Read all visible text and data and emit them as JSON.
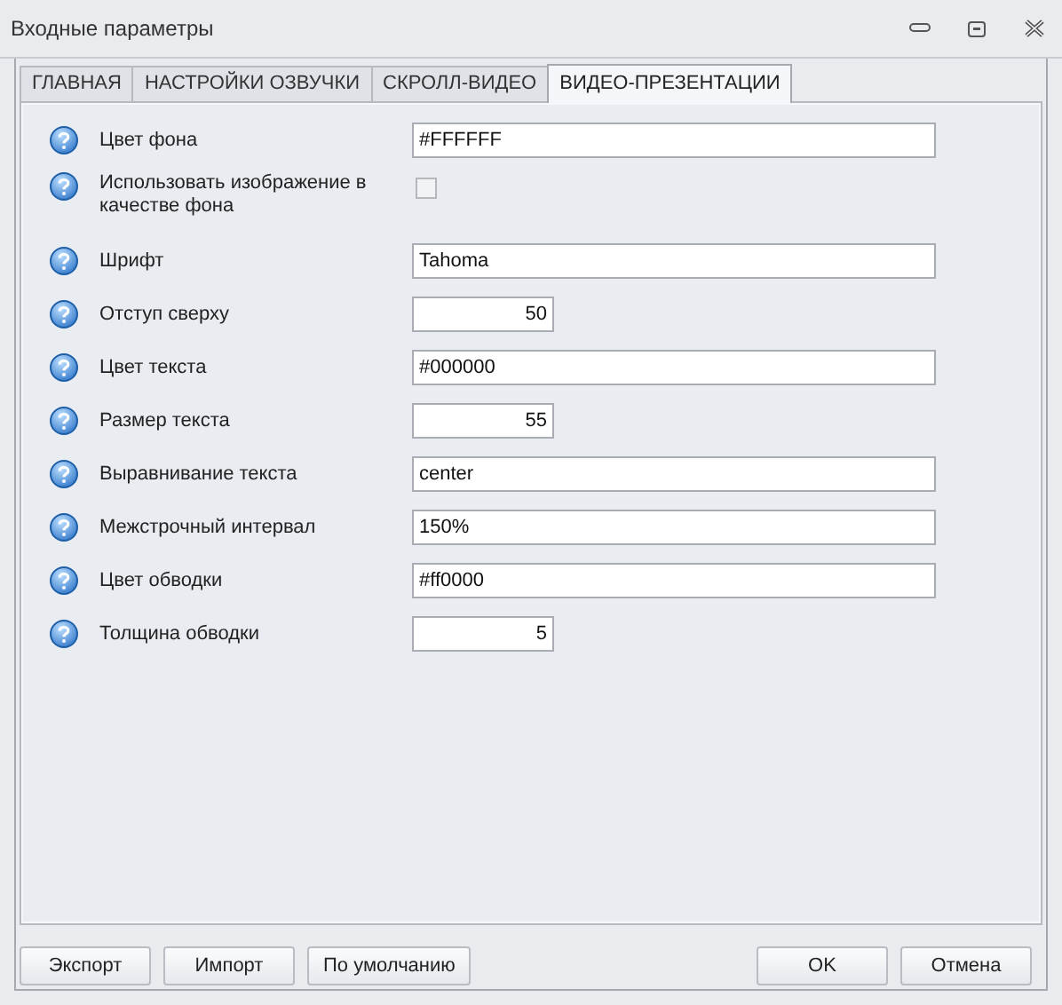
{
  "window": {
    "title": "Входные параметры"
  },
  "tabs": [
    {
      "label": "ГЛАВНАЯ",
      "selected": false
    },
    {
      "label": "НАСТРОЙКИ ОЗВУЧКИ",
      "selected": false
    },
    {
      "label": "СКРОЛЛ-ВИДЕО",
      "selected": false
    },
    {
      "label": "ВИДЕО-ПРЕЗЕНТАЦИИ",
      "selected": true
    }
  ],
  "fields": [
    {
      "kind": "text",
      "label": "Цвет фона",
      "value": "#FFFFFF"
    },
    {
      "kind": "checkbox",
      "label": "Использовать изображение в качестве фона",
      "checked": false
    },
    {
      "kind": "text",
      "label": "Шрифт",
      "value": "Tahoma"
    },
    {
      "kind": "number",
      "label": "Отступ сверху",
      "value": "50"
    },
    {
      "kind": "text",
      "label": "Цвет текста",
      "value": "#000000"
    },
    {
      "kind": "number",
      "label": "Размер текста",
      "value": "55"
    },
    {
      "kind": "text",
      "label": "Выравнивание текста",
      "value": "center"
    },
    {
      "kind": "text",
      "label": "Межстрочный интервал",
      "value": "150%"
    },
    {
      "kind": "text",
      "label": "Цвет обводки",
      "value": "#ff0000"
    },
    {
      "kind": "number",
      "label": "Толщина обводки",
      "value": "5"
    }
  ],
  "buttons_left": [
    "Экспорт",
    "Импорт",
    "По умолчанию"
  ],
  "buttons_right": [
    "OK",
    "Отмена"
  ]
}
